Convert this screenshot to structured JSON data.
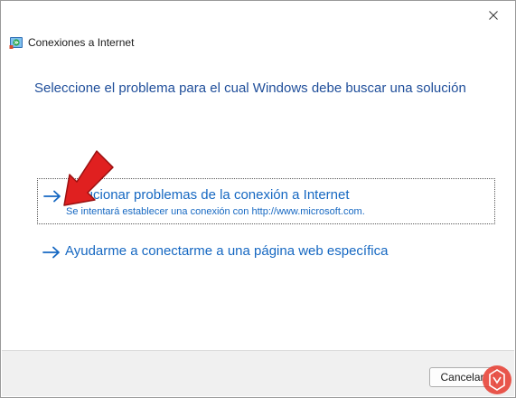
{
  "window": {
    "title": "Conexiones a Internet"
  },
  "heading": "Seleccione el problema para el cual Windows debe buscar una solución",
  "options": [
    {
      "label": "Solucionar problemas de la conexión a Internet",
      "description": "Se intentará establecer una conexión con http://www.microsoft.com.",
      "icon": "arrow-right-icon"
    },
    {
      "label": "Ayudarme a conectarme a una página web específica",
      "icon": "arrow-right-icon"
    }
  ],
  "footer": {
    "cancel_label": "Cancelar"
  },
  "colors": {
    "heading": "#1f4e9a",
    "link": "#1668c2",
    "annotation_arrow": "#e02020",
    "footer_bg": "#f0f0f0"
  }
}
